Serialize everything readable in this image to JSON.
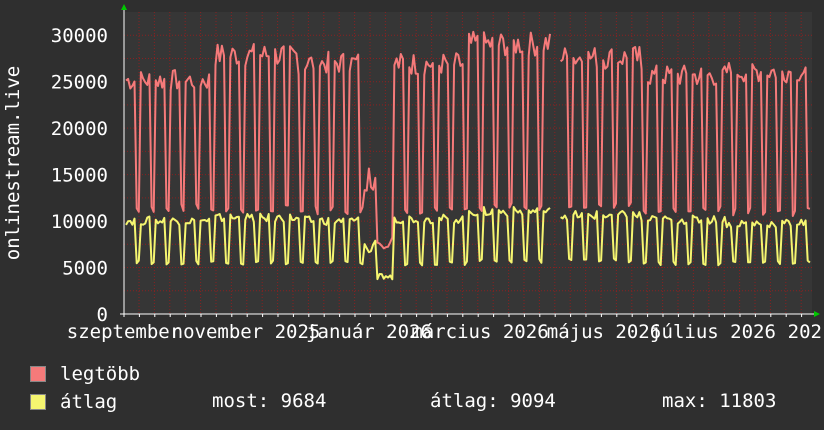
{
  "chart_data": {
    "type": "line",
    "ylabel": "onlinestream.live",
    "yticks": [
      0,
      5000,
      10000,
      15000,
      20000,
      25000,
      30000
    ],
    "ylim": [
      0,
      32500
    ],
    "xticks": [
      "szeptember 2025",
      "november 2025",
      "január 2026",
      "március 2026",
      "május 2026",
      "július 2026"
    ],
    "xticks_visible": [
      "szeptember",
      "november 2025",
      "január 2026",
      "március 2026",
      "május 2026",
      "július 2026"
    ],
    "xtick_trailing": "202",
    "grid": true,
    "series": [
      {
        "name": "legtöbb",
        "color": "#f57a7a",
        "peaks": [
          25800,
          28600,
          27700,
          27600,
          29800,
          28300,
          26300,
          26800
        ],
        "lows": [
          11500,
          11400,
          11300,
          11200,
          11600,
          12000,
          11300,
          11100
        ],
        "max": 31200
      },
      {
        "name": "átlag",
        "color": "#f5f570",
        "peaks": [
          10300,
          10600,
          10300,
          10500,
          11300,
          10900,
          10400,
          10000
        ],
        "lows": [
          5600,
          5600,
          5600,
          5500,
          5800,
          5800,
          5500,
          5600
        ],
        "max": 11803
      }
    ]
  },
  "legend": {
    "items": [
      {
        "label": "legtöbb",
        "color": "#f57a7a"
      },
      {
        "label": "átlag",
        "color": "#f5f570"
      }
    ],
    "now": "most: 9684",
    "avg": "átlag: 9094",
    "max": "max: 11803"
  },
  "colors": {
    "background": "#2f2f2f",
    "plot": "#363636",
    "grid": "#8a2020",
    "axis": "#ffffff",
    "arrow": "#00c800"
  }
}
